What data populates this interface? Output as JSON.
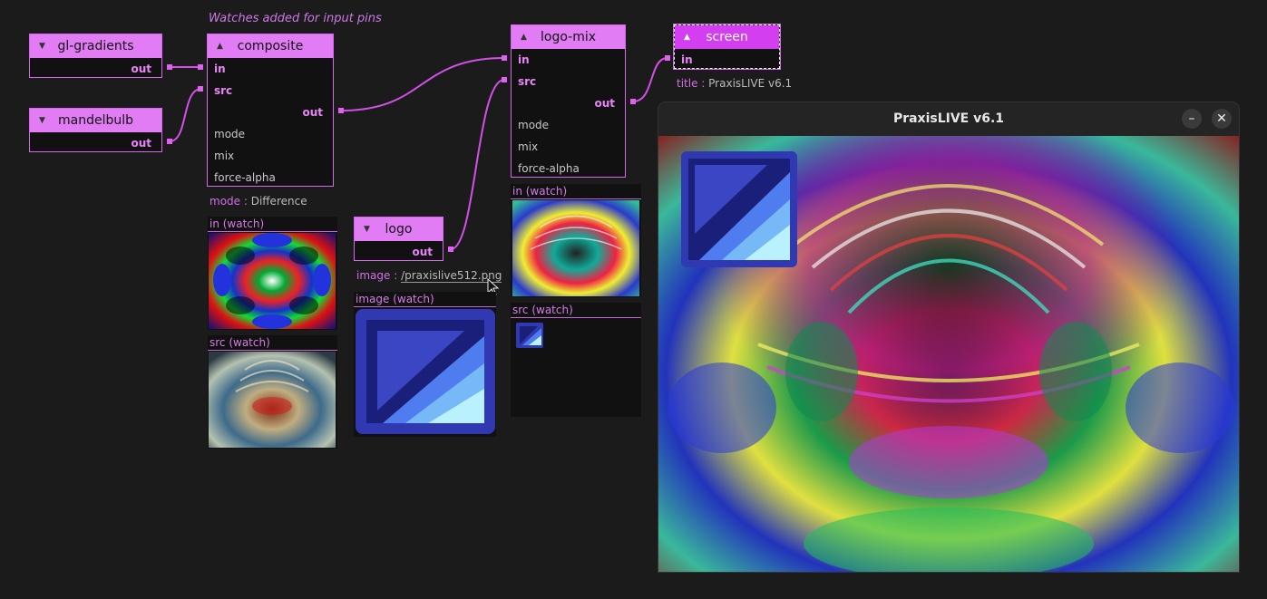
{
  "annotation": "Watches added for input pins",
  "nodes": {
    "gl_gradients": {
      "title": "gl-gradients",
      "out": "out"
    },
    "mandelbulb": {
      "title": "mandelbulb",
      "out": "out"
    },
    "composite": {
      "title": "composite",
      "in": "in",
      "src": "src",
      "out": "out",
      "mode": "mode",
      "mix": "mix",
      "force_alpha": "force-alpha"
    },
    "logo": {
      "title": "logo",
      "out": "out"
    },
    "logo_mix": {
      "title": "logo-mix",
      "in": "in",
      "src": "src",
      "out": "out",
      "mode": "mode",
      "mix": "mix",
      "force_alpha": "force-alpha"
    },
    "screen": {
      "title": "screen",
      "in": "in"
    }
  },
  "properties": {
    "composite_mode": {
      "key": "mode :",
      "value": "Difference"
    },
    "logo_image": {
      "key": "image :",
      "value": "/praxislive512.png"
    },
    "screen_title": {
      "key": "title :",
      "value": "PraxisLIVE v6.1"
    }
  },
  "watches": {
    "composite_in": "in (watch)",
    "composite_src": "src (watch)",
    "logo_image": "image (watch)",
    "logo_mix_in": "in (watch)",
    "logo_mix_src": "src (watch)"
  },
  "window": {
    "title": "PraxisLIVE v6.1",
    "minimize": "–",
    "close": "✕"
  },
  "colors": {
    "accent": "#e27cf5",
    "wire": "#d34fe8",
    "background": "#1b1b1b"
  }
}
